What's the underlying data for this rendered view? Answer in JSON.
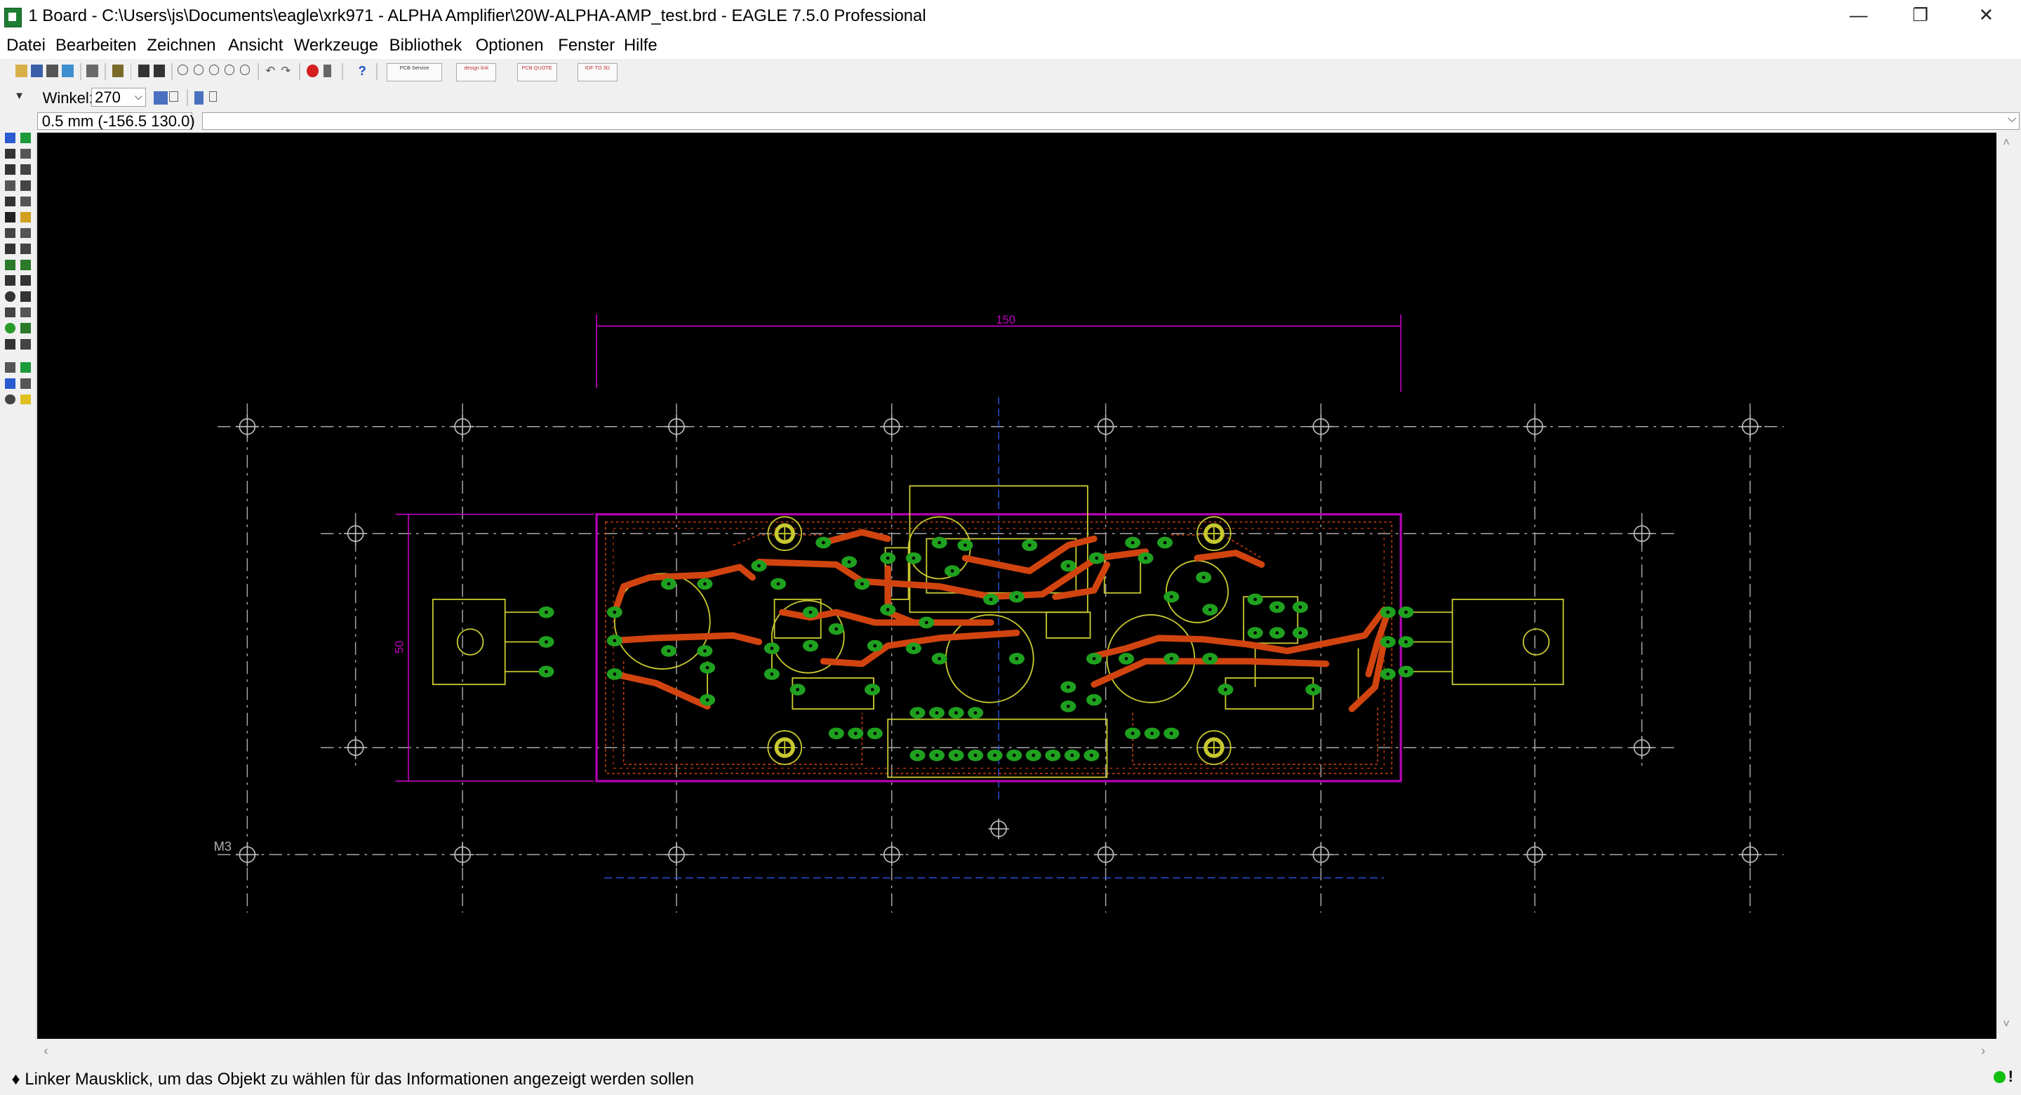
{
  "window": {
    "title": "1 Board - C:\\Users\\js\\Documents\\eagle\\xrk971 - ALPHA Amplifier\\20W-ALPHA-AMP_test.brd - EAGLE 7.5.0 Professional",
    "minimize_glyph": "—",
    "restore_glyph": "❐",
    "close_glyph": "✕"
  },
  "menu": {
    "items": [
      "Datei",
      "Bearbeiten",
      "Zeichnen",
      "Ansicht",
      "Werkzeuge",
      "Bibliothek",
      "Optionen",
      "Fenster",
      "Hilfe"
    ]
  },
  "toolbar": {
    "dropdown_glyph": "▼",
    "winkel_label": "Winkel:",
    "winkel_value": "270",
    "chevron": "⌵",
    "logo_labels": [
      "PCB Service",
      "design link",
      "PCB QUOTE",
      "IDF TO 3D"
    ]
  },
  "command": {
    "coordinate": "0.5 mm (-156.5 130.0)"
  },
  "board": {
    "dimension_width": "150",
    "dimension_height": "50",
    "layer_label": "M3",
    "colors": {
      "background": "#000000",
      "outline": "#b000b0",
      "dimension": "#c000c0",
      "top_copper": "#d2440f",
      "pads": "#1fa11f",
      "silkscreen": "#c8c830",
      "grid": "#a8a8a8",
      "bottom_copper": "#1a3fbf"
    }
  },
  "status": {
    "message": "♦ Linker Mausklick, um das Objekt zu wählen für das Informationen angezeigt werden sollen",
    "scroll_left": "‹",
    "scroll_right": "›",
    "scroll_up": "˄",
    "scroll_down": "˅",
    "indicator": "!"
  },
  "tool_icons": [
    "info-icon",
    "show-icon",
    "display-icon",
    "mark-icon",
    "move-icon",
    "copy-icon",
    "mirror-icon",
    "rotate-icon",
    "group-icon",
    "change-icon",
    "delete-icon",
    "add-icon",
    "paste-icon",
    "smash-icon",
    "split-icon",
    "miter-icon",
    "route-icon",
    "ripup-icon",
    "wire-icon",
    "text-icon",
    "circle-icon",
    "arc-icon",
    "rect-icon",
    "polygon-icon",
    "via-icon",
    "signal-icon",
    "hole-icon",
    "attribute-icon",
    "dimension-icon",
    "ratsnest-icon",
    "auto-icon",
    "drc-icon",
    "errors-icon",
    "erc-icon"
  ]
}
